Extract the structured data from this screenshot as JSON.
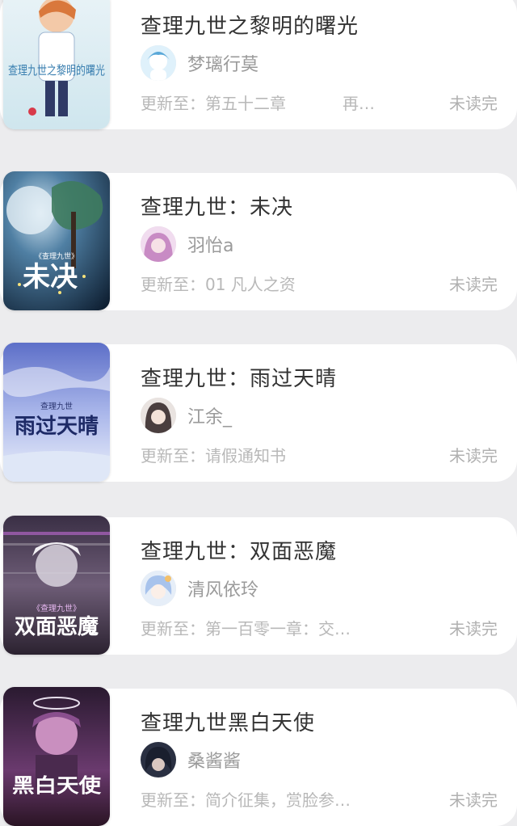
{
  "books": [
    {
      "title": "查理九世之黎明的曙光",
      "author": "梦璃行莫",
      "update": "更新至：第五十二章",
      "extra": "再…",
      "status": "未读完",
      "cover_text": "查理九世之黎明的曙光"
    },
    {
      "title": "查理九世：未决",
      "author": "羽怡a",
      "update": "更新至：01 凡人之资",
      "status": "未读完",
      "cover_text": "未决",
      "cover_subtext": "《查理九世》"
    },
    {
      "title": "查理九世：雨过天晴",
      "author": "江余_",
      "update": "更新至：请假通知书",
      "status": "未读完",
      "cover_text": "雨过天晴",
      "cover_subtext": "查理九世"
    },
    {
      "title": "查理九世：双面恶魔",
      "author": "清风依玲",
      "update": "更新至：第一百零一章：交…",
      "status": "未读完",
      "cover_text": "双面恶魔",
      "cover_subtext": "《查理九世》"
    },
    {
      "title": "查理九世黑白天使",
      "author": "桑酱酱",
      "update": "更新至：简介征集，赏脸参…",
      "status": "未读完",
      "cover_text": "黑白天使"
    }
  ],
  "colors": {
    "background": "#ececee",
    "card": "#ffffff",
    "title_text": "#333333",
    "meta_text": "#b8b8b8"
  }
}
